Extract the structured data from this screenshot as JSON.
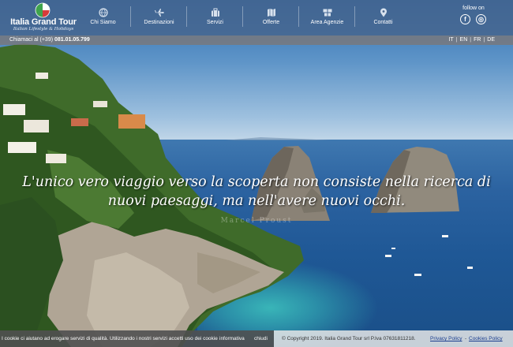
{
  "brand": {
    "name": "Italia Grand Tour",
    "tagline": "Italian Lifestyle & Holidays"
  },
  "nav": {
    "items": [
      {
        "label": "Chi Siamo",
        "icon": "globe-icon"
      },
      {
        "label": "Destinazioni",
        "icon": "airplane-icon"
      },
      {
        "label": "Servizi",
        "icon": "suitcase-icon"
      },
      {
        "label": "Offerte",
        "icon": "map-icon"
      },
      {
        "label": "Area Agenzie",
        "icon": "people-icon"
      },
      {
        "label": "Contatti",
        "icon": "location-pin-icon"
      }
    ]
  },
  "social": {
    "label": "follow on",
    "facebook": "f",
    "instagram": "◎"
  },
  "contact": {
    "prefix": "Chiamaci al (+39)",
    "number": "081.01.05.799"
  },
  "languages": [
    "IT",
    "EN",
    "FR",
    "DE"
  ],
  "hero": {
    "quote_line1": "L'unico vero viaggio verso la scoperta non consiste nella ricerca di",
    "quote_line2": "nuovi paesaggi, ma nell'avere nuovi occhi.",
    "author": "Marcel Proust"
  },
  "cookie": {
    "message": "I cookie ci aiutano ad erogare servizi di qualità. Utilizzando i nostri servizi accetti uso dei cookie",
    "info_label": "informativa",
    "close_label": "chiudi"
  },
  "footer": {
    "copyright": "© Copyright 2019. Italia Grand Tour srl P.Iva 07631811218.",
    "privacy_label": "Privacy Policy",
    "separator": "-",
    "cookies_label": "Cookies Policy"
  },
  "colors": {
    "header_bg": "#46648c",
    "subbar_bg": "#78787d",
    "link": "#1a3d8f"
  }
}
